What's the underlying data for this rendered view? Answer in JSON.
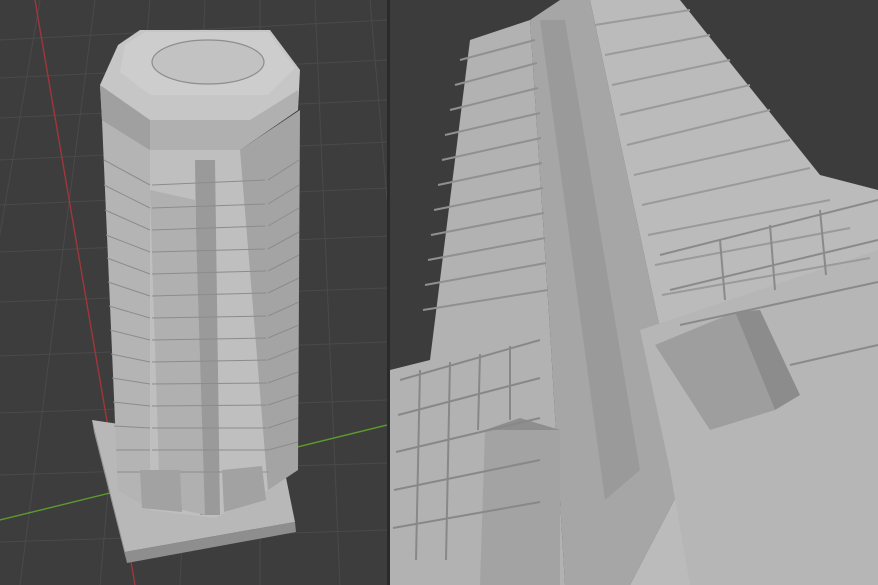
{
  "scene": {
    "viewports": [
      {
        "name": "perspective-full-view",
        "content": "skyscraper-3d-model"
      },
      {
        "name": "closeup-view",
        "content": "skyscraper-3d-model"
      }
    ],
    "colors": {
      "background_left": "#3d3d3d",
      "background_right": "#3c3c3c",
      "grid_line": "#4a4a4a",
      "axis_x": "#a0363a",
      "axis_y": "#5e9a2c",
      "model_light": "#c4c4c4",
      "model_mid": "#a9a9a9",
      "model_dark": "#8a8a8a",
      "model_edge": "#6e6e6e"
    }
  }
}
